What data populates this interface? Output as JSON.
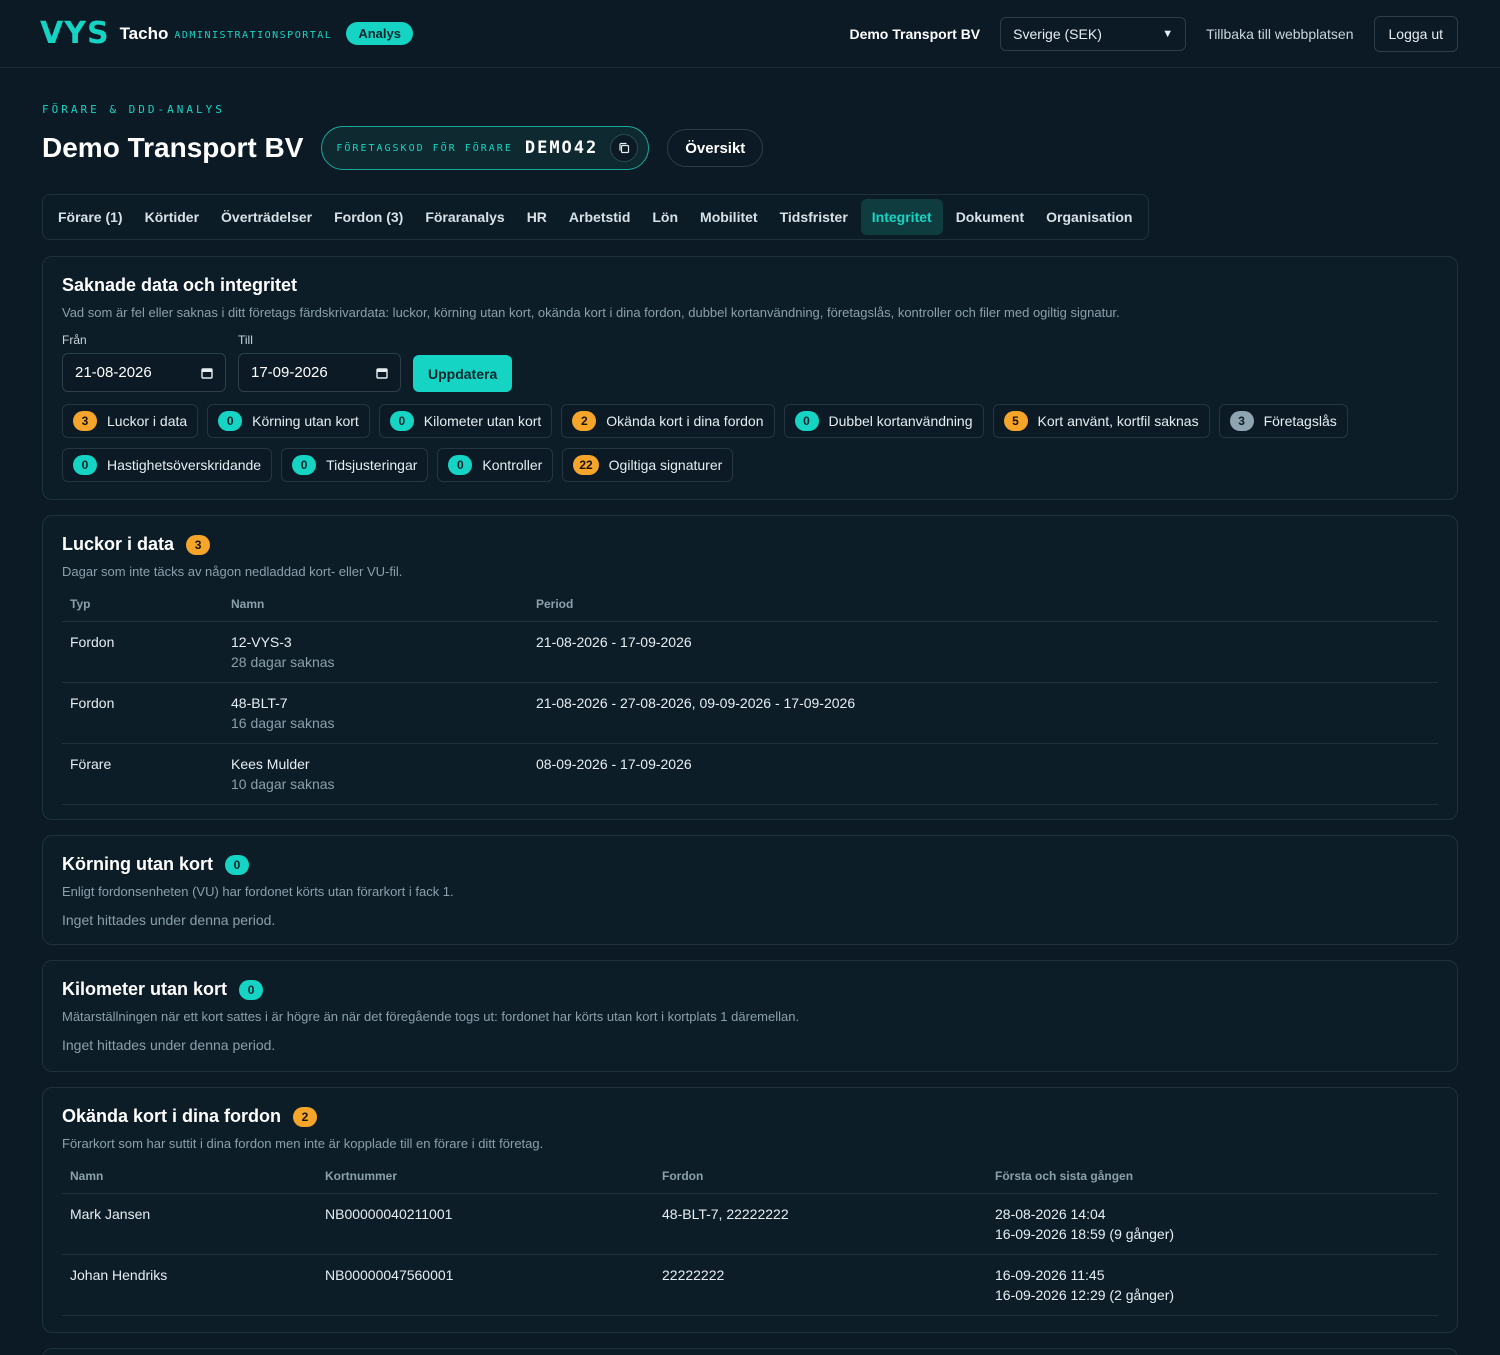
{
  "header": {
    "logo_mark": "VYS",
    "logo_name": "Tacho",
    "logo_sub": "ADMINISTRATIONSPORTAL",
    "badge": "Analys",
    "company": "Demo Transport BV",
    "region_select": "Sverige (SEK)",
    "back_link": "Tillbaka till webbplatsen",
    "logout": "Logga ut"
  },
  "page": {
    "eyebrow": "FÖRARE & DDD-ANALYS",
    "title": "Demo Transport BV",
    "code_label": "FÖRETAGSKOD FÖR FÖRARE",
    "code_value": "DEMO42",
    "overview_button": "Översikt"
  },
  "tabs": [
    {
      "label": "Förare (1)"
    },
    {
      "label": "Körtider"
    },
    {
      "label": "Överträdelser"
    },
    {
      "label": "Fordon (3)"
    },
    {
      "label": "Föraranalys"
    },
    {
      "label": "HR"
    },
    {
      "label": "Arbetstid"
    },
    {
      "label": "Lön"
    },
    {
      "label": "Mobilitet"
    },
    {
      "label": "Tidsfrister"
    },
    {
      "label": "Integritet"
    },
    {
      "label": "Dokument"
    },
    {
      "label": "Organisation"
    }
  ],
  "integrity": {
    "title": "Saknade data och integritet",
    "desc": "Vad som är fel eller saknas i ditt företags färdskrivardata: luckor, körning utan kort, okända kort i dina fordon, dubbel kortanvändning, företagslås, kontroller och filer med ogiltig signatur.",
    "from_label": "Från",
    "from_value": "21-08-2026",
    "to_label": "Till",
    "to_value": "17-09-2026",
    "update_button": "Uppdatera",
    "chips": [
      {
        "count": "3",
        "label": "Luckor i data",
        "color": "orange"
      },
      {
        "count": "0",
        "label": "Körning utan kort",
        "color": "teal"
      },
      {
        "count": "0",
        "label": "Kilometer utan kort",
        "color": "teal"
      },
      {
        "count": "2",
        "label": "Okända kort i dina fordon",
        "color": "orange"
      },
      {
        "count": "0",
        "label": "Dubbel kortanvändning",
        "color": "teal"
      },
      {
        "count": "5",
        "label": "Kort använt, kortfil saknas",
        "color": "orange"
      },
      {
        "count": "3",
        "label": "Företagslås",
        "color": "grey"
      },
      {
        "count": "0",
        "label": "Hastighetsöverskridande",
        "color": "teal"
      },
      {
        "count": "0",
        "label": "Tidsjusteringar",
        "color": "teal"
      },
      {
        "count": "0",
        "label": "Kontroller",
        "color": "teal"
      },
      {
        "count": "22",
        "label": "Ogiltiga signaturer",
        "color": "orange"
      }
    ]
  },
  "gaps": {
    "title": "Luckor i data",
    "count": "3",
    "desc": "Dagar som inte täcks av någon nedladdad kort- eller VU-fil.",
    "headers": [
      "Typ",
      "Namn",
      "Period"
    ],
    "rows": [
      {
        "type": "Fordon",
        "name": "12-VYS-3",
        "sub": "28 dagar saknas",
        "period": "21-08-2026 - 17-09-2026"
      },
      {
        "type": "Fordon",
        "name": "48-BLT-7",
        "sub": "16 dagar saknas",
        "period": "21-08-2026 - 27-08-2026, 09-09-2026 - 17-09-2026"
      },
      {
        "type": "Förare",
        "name": "Kees Mulder",
        "sub": "10 dagar saknas",
        "period": "08-09-2026 - 17-09-2026"
      }
    ]
  },
  "no_card": {
    "title": "Körning utan kort",
    "count": "0",
    "desc": "Enligt fordonsenheten (VU) har fordonet körts utan förarkort i fack 1.",
    "empty": "Inget hittades under denna period."
  },
  "km_no_card": {
    "title": "Kilometer utan kort",
    "count": "0",
    "desc": "Mätarställningen när ett kort sattes i är högre än när det föregående togs ut: fordonet har körts utan kort i kortplats 1 däremellan.",
    "empty": "Inget hittades under denna period."
  },
  "unknown_cards": {
    "title": "Okända kort i dina fordon",
    "count": "2",
    "desc": "Förarkort som har suttit i dina fordon men inte är kopplade till en förare i ditt företag.",
    "headers": [
      "Namn",
      "Kortnummer",
      "Fordon",
      "Första och sista gången"
    ],
    "rows": [
      {
        "name": "Mark Jansen",
        "card": "NB00000040211001",
        "vehicle": "48-BLT-7, 22222222",
        "first": "28-08-2026 14:04",
        "last": "16-09-2026 18:59 (9 gånger)"
      },
      {
        "name": "Johan Hendriks",
        "card": "NB00000047560001",
        "vehicle": "22222222",
        "first": "16-09-2026 11:45",
        "last": "16-09-2026 12:29 (2 gånger)"
      }
    ]
  },
  "colors": {
    "accent": "#16d4c4",
    "warning": "#f4a52a",
    "neutral": "#8ea4b0",
    "background": "#0b1a24"
  }
}
